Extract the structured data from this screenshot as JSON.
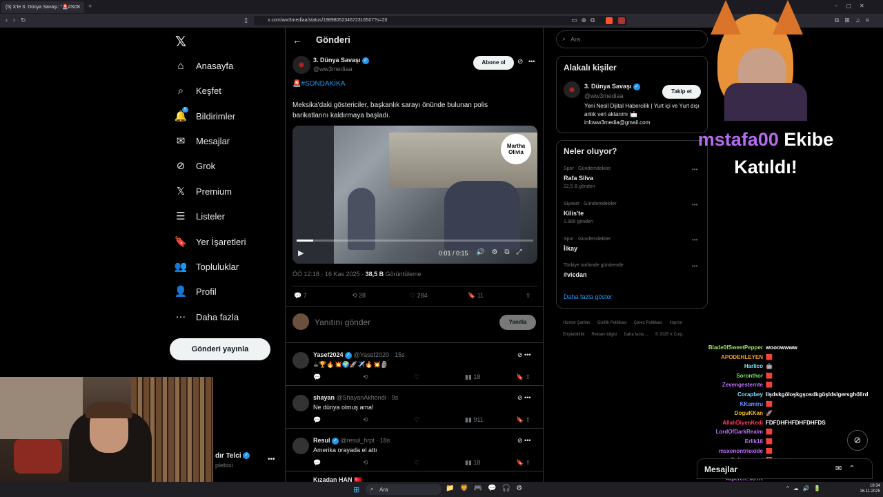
{
  "browser": {
    "tab_title": "(5) X'te 3. Dünya Savaşı: \"🚨#SO",
    "url": "x.com/ww3mediaa/status/1989805234672316507?s=20",
    "new_tab": "+"
  },
  "nav": {
    "items": [
      {
        "label": "Anasayfa",
        "icon": "home-icon"
      },
      {
        "label": "Keşfet",
        "icon": "search-icon"
      },
      {
        "label": "Bildirimler",
        "icon": "bell-icon",
        "badge": "5"
      },
      {
        "label": "Mesajlar",
        "icon": "mail-icon"
      },
      {
        "label": "Grok",
        "icon": "grok-icon"
      },
      {
        "label": "Premium",
        "icon": "x-logo-icon"
      },
      {
        "label": "Listeler",
        "icon": "list-icon"
      },
      {
        "label": "Yer İşaretleri",
        "icon": "bookmark-icon"
      },
      {
        "label": "Topluluklar",
        "icon": "people-icon"
      },
      {
        "label": "Profil",
        "icon": "person-icon"
      },
      {
        "label": "Daha fazla",
        "icon": "more-circle-icon"
      }
    ],
    "post_button": "Gönderi yayınla",
    "account_name": "dır Telci",
    "account_handle": "plebixi"
  },
  "header": {
    "title": "Gönderi"
  },
  "post": {
    "author": "3. Dünya Savaşı",
    "handle": "@ww3mediaa",
    "follow_label": "Abone ol",
    "hashtag": "🚨#SONDAKİKA",
    "text": "Meksika'daki göstericiler, başkanlık sarayı önünde bulunan polis barikatlarını kaldırmaya başladı.",
    "video": {
      "watermark_line1": "Martha",
      "watermark_line2": "Olivia",
      "time": "0:01 / 0:15",
      "progress": 0.07
    },
    "timestamp": "ÖÖ 12:18 · 16 Kas 2025 ·",
    "views": "38,5 B",
    "views_label": "Görüntüleme",
    "stats": {
      "replies": "7",
      "reposts": "28",
      "likes": "284",
      "bookmarks": "11"
    }
  },
  "composer": {
    "placeholder": "Yanıtını gönder",
    "button": "Yanıtla"
  },
  "replies": [
    {
      "name": "Yasef2024",
      "handle": "@Yasef2020 · 15s",
      "verified": true,
      "text": "☕🏆🔥💥🌍🚀✈️🔥💥🗿",
      "views": "18"
    },
    {
      "name": "shayan",
      "handle": "@ShayanAkhondi · 9s",
      "verified": false,
      "text": "Ne dünya olmuş ama!",
      "views": "911"
    },
    {
      "name": "Resul",
      "handle": "@resul_hrpt · 18s",
      "verified": true,
      "text": "Amerika orayada el attı",
      "views": "18"
    }
  ],
  "next_reply_partial": "Kızadan HAN 🇹🇷",
  "right": {
    "search_placeholder": "Ara",
    "related_title": "Alakalı kişiler",
    "related": {
      "name": "3. Dünya Savaşı",
      "handle": "@ww3mediaa",
      "follow": "Takip et",
      "bio": "Yeni Nesil Dijital Habercilik | Yurt içi ve Yurt dışı anlık veri aktarımı |📩 infoww3media@gmail.com"
    },
    "trends_title": "Neler oluyor?",
    "trends": [
      {
        "meta": "Spor · Gündemdekiler",
        "name": "Rafa Silva",
        "sub": "22,5 B gönderi"
      },
      {
        "meta": "Siyaset · Gündemdekiler",
        "name": "Kilis'te",
        "sub": "1.995 gönderi"
      },
      {
        "meta": "Spor · Gündemdekiler",
        "name": "İlkay",
        "sub": ""
      },
      {
        "meta": "Türkiye tarihinde gündemde",
        "name": "#vicdan",
        "sub": ""
      }
    ],
    "show_more": "Daha fazla göster",
    "footer": [
      "Hizmet Şartları",
      "Gizlilik Politikası",
      "Çerez Politikası",
      "Imprint",
      "Erişilebilirlik",
      "Reklam bilgisi",
      "Daha fazla ...",
      "© 2025 X Corp."
    ],
    "messages_label": "Mesajlar"
  },
  "overlay": {
    "highlight": "mstafa00",
    "title_rest": " Ekibe",
    "title_line2": "Katıldı!",
    "chat": [
      {
        "name": "Blade0fSweetPepper",
        "color": "#9be36b",
        "msg": "wooowwww"
      },
      {
        "name": "APODEHLEYEN",
        "color": "#f0a020",
        "msg": "🟥"
      },
      {
        "name": "Harlico",
        "color": "#7ce1ff",
        "msg": "🤖"
      },
      {
        "name": "Soronthor",
        "color": "#7ce36b",
        "msg": "🟥"
      },
      {
        "name": "Zevengesternte",
        "color": "#c070ff",
        "msg": "🟥"
      },
      {
        "name": "Corapbey",
        "color": "#7ce1ff",
        "msg": "lişdskgöloşkgşosdkgöşldslgersghöllrd"
      },
      {
        "name": "KKamiru",
        "color": "#7090ff",
        "msg": "🟥"
      },
      {
        "name": "DoguKKan",
        "color": "#f0c020",
        "msg": "🚀"
      },
      {
        "name": "AllahDiyenKedi",
        "color": "#ff4060",
        "msg": "FDFDHFHFDHFDHFDS"
      },
      {
        "name": "LordOfDarkRealm",
        "color": "#c070ff",
        "msg": "🟥"
      },
      {
        "name": "Erlik16",
        "color": "#c070ff",
        "msg": "🟥"
      },
      {
        "name": "msxenontrioxide",
        "color": "#c070ff",
        "msg": "🟥"
      },
      {
        "name": "Sultanmerut",
        "color": "#7ce36b",
        "msg": "🟥"
      },
      {
        "name": "SeljukBeg",
        "color": "#ff4060",
        "msg": "monkey D. luffy"
      },
      {
        "name": "Alperen_03TR",
        "color": "#c070ff",
        "msg": ""
      }
    ]
  },
  "taskbar": {
    "search": "Ara",
    "time": "18:34",
    "date": "16.11.2025"
  }
}
